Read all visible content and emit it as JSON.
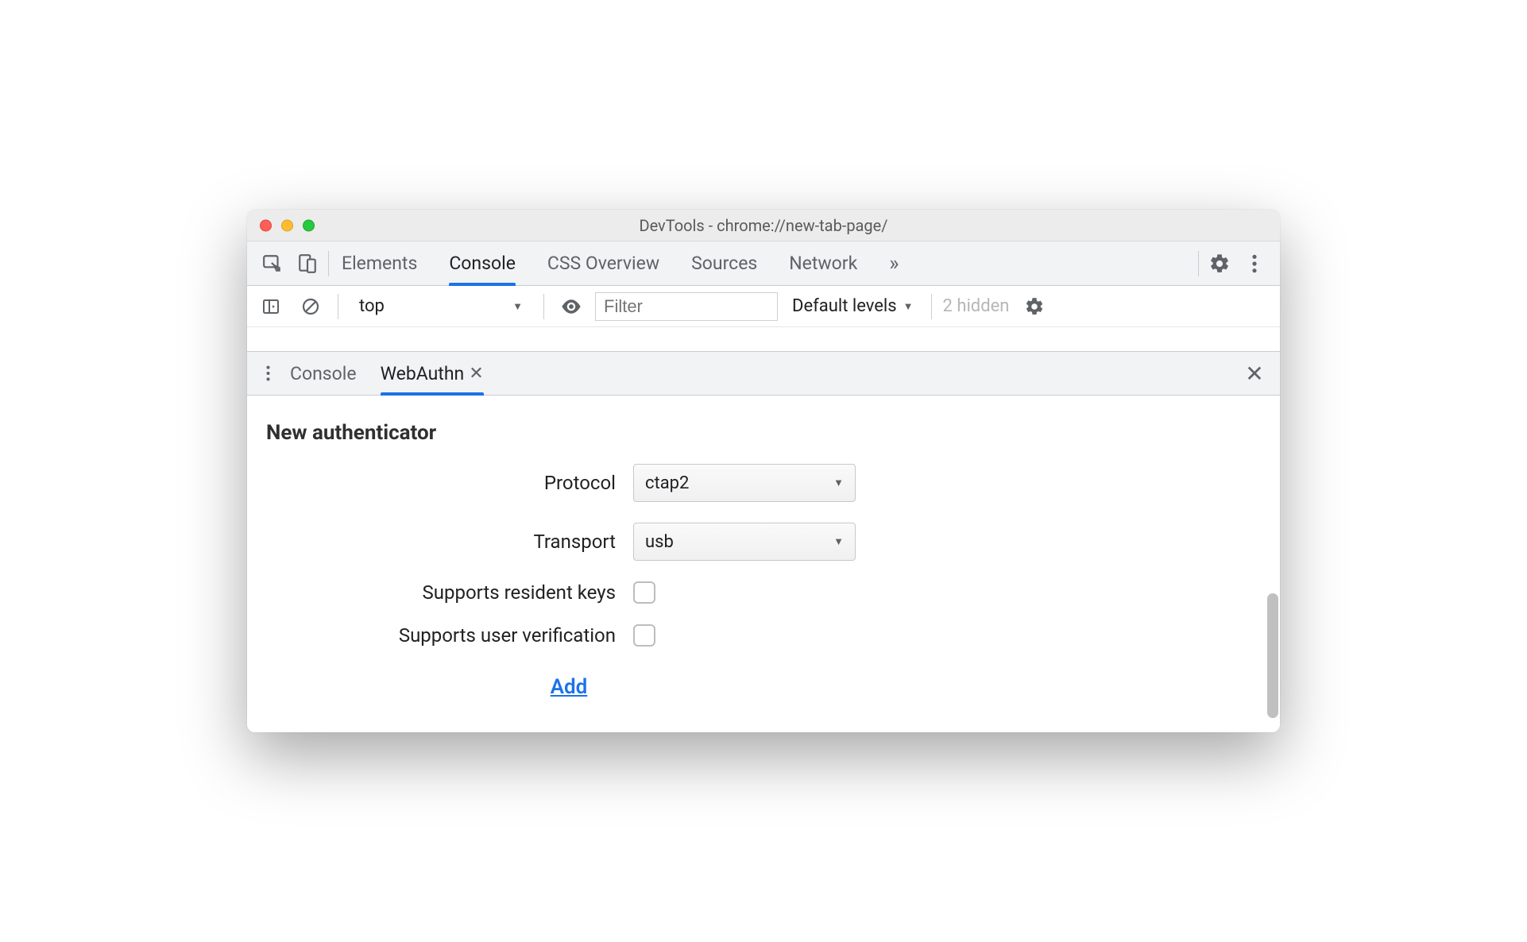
{
  "window": {
    "title": "DevTools - chrome://new-tab-page/"
  },
  "main_tabs": {
    "items": [
      {
        "label": "Elements",
        "active": false
      },
      {
        "label": "Console",
        "active": true
      },
      {
        "label": "CSS Overview",
        "active": false
      },
      {
        "label": "Sources",
        "active": false
      },
      {
        "label": "Network",
        "active": false
      }
    ],
    "more_icon": "»"
  },
  "console_toolbar": {
    "context": "top",
    "filter_placeholder": "Filter",
    "levels_label": "Default levels",
    "hidden_label": "2 hidden"
  },
  "drawer_tabs": {
    "items": [
      {
        "label": "Console",
        "active": false
      },
      {
        "label": "WebAuthn",
        "active": true,
        "closable": true
      }
    ]
  },
  "webauthn": {
    "heading": "New authenticator",
    "fields": {
      "protocol_label": "Protocol",
      "protocol_value": "ctap2",
      "transport_label": "Transport",
      "transport_value": "usb",
      "resident_keys_label": "Supports resident keys",
      "resident_keys_checked": false,
      "user_verification_label": "Supports user verification",
      "user_verification_checked": false
    },
    "add_label": "Add"
  }
}
